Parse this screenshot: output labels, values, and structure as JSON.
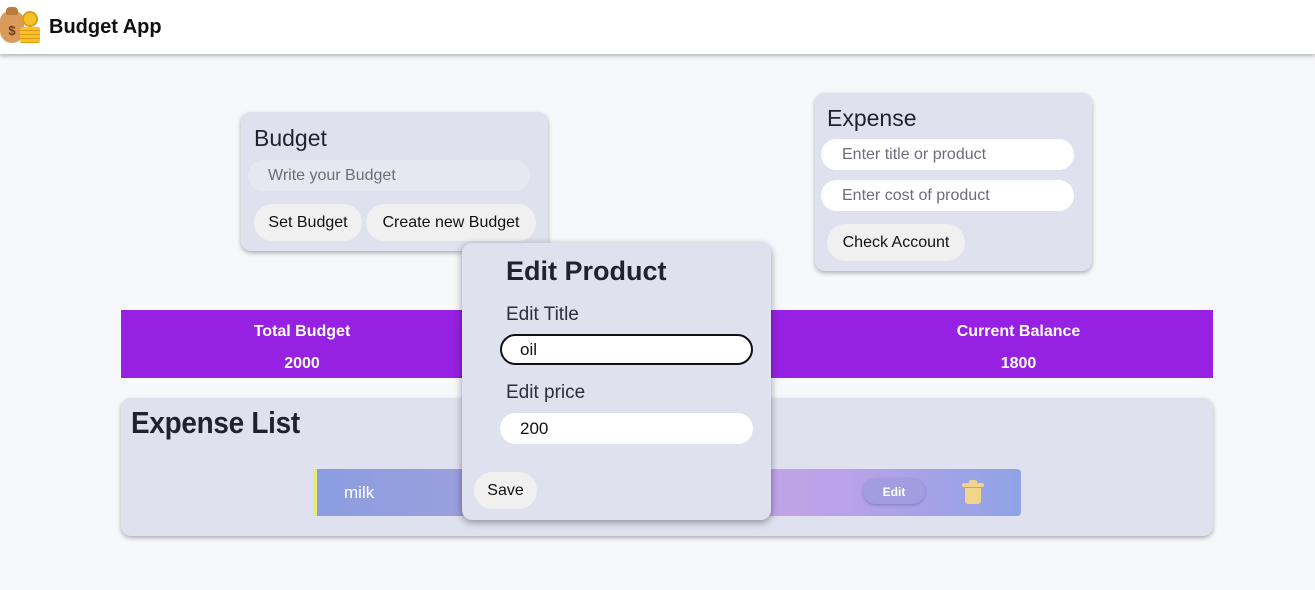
{
  "header": {
    "title": "Budget App",
    "logo_icons": [
      "money-bag-icon",
      "coin-stack-icon"
    ],
    "bag_symbol": "$"
  },
  "budget_card": {
    "title": "Budget",
    "input_placeholder": "Write your Budget",
    "input_value": "",
    "set_button": "Set Budget",
    "create_button": "Create new Budget"
  },
  "expense_card": {
    "title": "Expense",
    "title_placeholder": "Enter title or product",
    "cost_placeholder": "Enter cost of product",
    "check_button": "Check Account"
  },
  "summary": {
    "accent_color": "#9621e2",
    "total_budget_label": "Total Budget",
    "total_budget_value": "2000",
    "current_balance_label": "Current Balance",
    "current_balance_value": "1800"
  },
  "expense_list": {
    "title": "Expense List",
    "items": [
      {
        "name": "milk",
        "edit_label": "Edit",
        "delete_icon": "trash-icon"
      }
    ]
  },
  "edit_modal": {
    "title": "Edit Product",
    "title_label": "Edit Title",
    "title_value": "oil",
    "price_label": "Edit price",
    "price_value": "200",
    "save_button": "Save"
  }
}
